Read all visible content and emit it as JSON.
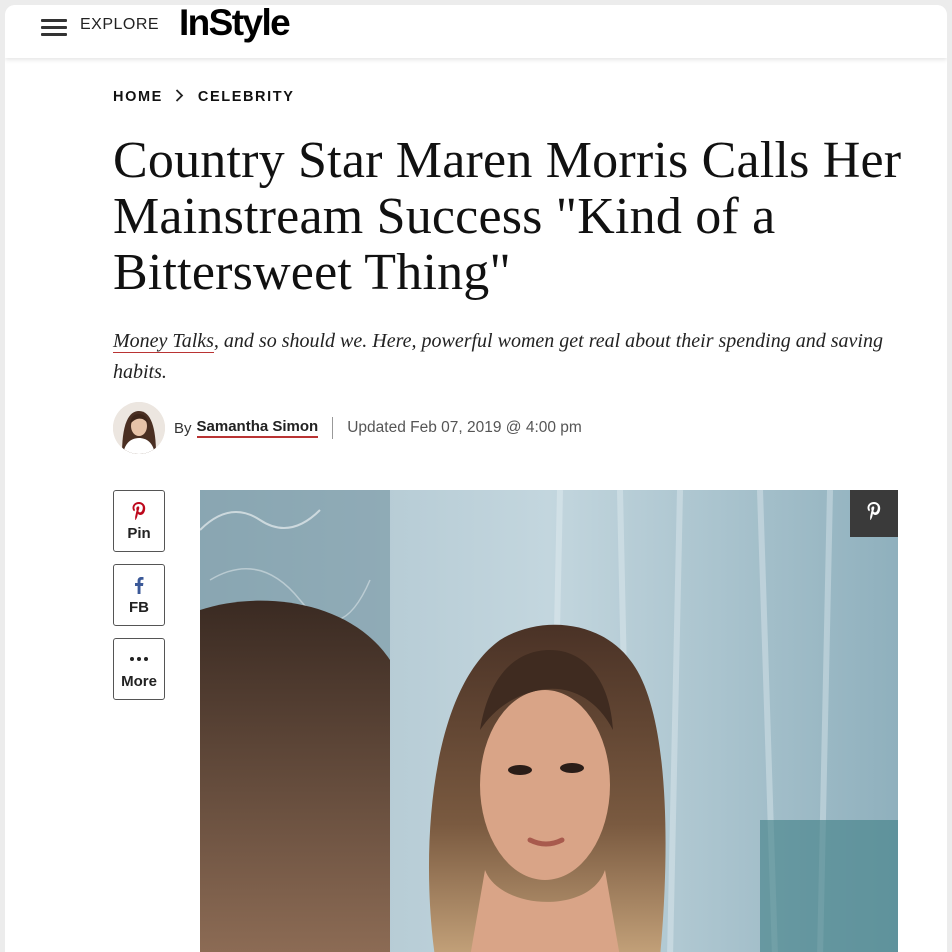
{
  "header": {
    "explore_label": "EXPLORE",
    "logo_text": "InStyle"
  },
  "breadcrumb": {
    "home": "HOME",
    "separator": "›",
    "section": "CELEBRITY"
  },
  "article": {
    "headline": "Country Star Maren Morris Calls Her Mainstream Success \"Kind of a Bittersweet Thing\"",
    "dek_link": "Money Talks",
    "dek_text": ", and so should we. Here, powerful women get real about their spending and saving habits.",
    "byline_prefix": "By",
    "author": "Samantha Simon",
    "updated": "Updated Feb 07, 2019 @ 4:00 pm"
  },
  "share": {
    "pin_label": "Pin",
    "fb_label": "FB",
    "more_label": "More"
  },
  "colors": {
    "accent_underline": "#b93333",
    "pinterest_red": "#bd081c",
    "facebook_blue": "#3b5998"
  },
  "icons": {
    "menu": "hamburger-menu-icon",
    "pinterest": "pinterest-icon",
    "facebook": "facebook-icon",
    "more": "more-dots-icon"
  }
}
